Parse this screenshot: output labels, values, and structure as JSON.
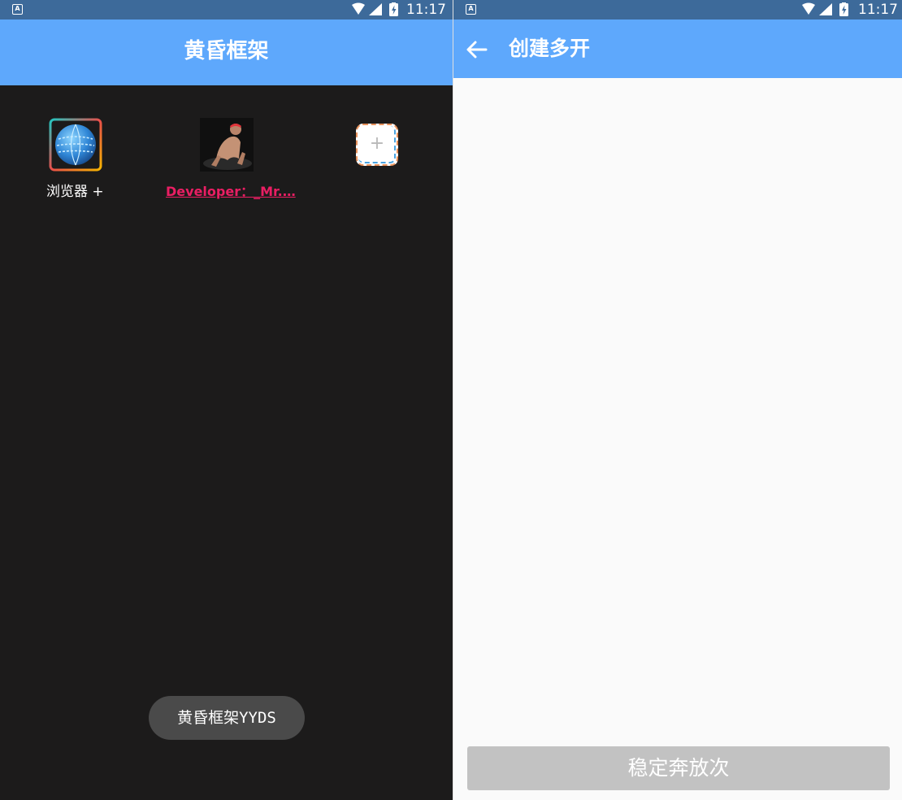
{
  "status_bar": {
    "time": "11:17",
    "notification_icon": "a-letter-icon",
    "icons": [
      "wifi-icon",
      "signal-icon",
      "battery-charging-icon"
    ]
  },
  "home_screen": {
    "title": "黄昏框架",
    "apps": [
      {
        "label": "浏览器 +",
        "icon": "globe-browser-icon"
      },
      {
        "label": "Developer：_Mr.…",
        "icon": "developer-avatar-icon"
      }
    ],
    "add_tile": {
      "glyph": "+",
      "icon": "add-icon"
    },
    "toast": "黄昏框架YYDS"
  },
  "create_screen": {
    "title": "创建多开",
    "back_icon": "arrow-back-icon",
    "button_label": "稳定奔放次"
  },
  "colors": {
    "status_bar": "#3d6a9a",
    "app_bar": "#5ea8fc",
    "home_background": "#1c1b1b",
    "create_background": "#fafafa",
    "developer_label": "#ea1e63",
    "toast_background": "#4a4a4a",
    "disabled_button": "#c2c2c2"
  }
}
